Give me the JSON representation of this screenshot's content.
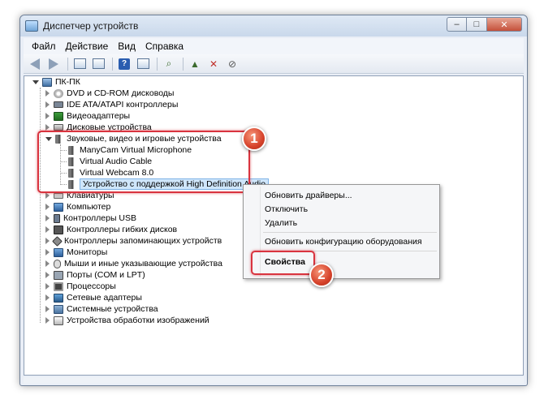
{
  "window": {
    "title": "Диспетчер устройств",
    "buttons": {
      "minimize": "–",
      "maximize": "□",
      "close": "✕"
    }
  },
  "menubar": [
    "Файл",
    "Действие",
    "Вид",
    "Справка"
  ],
  "toolbar": {
    "help_label": "?"
  },
  "tree": {
    "root": "ПК-ПК",
    "categories": [
      "DVD и CD-ROM дисководы",
      "IDE ATA/ATAPI контроллеры",
      "Видеоадаптеры",
      "Дисковые устройства",
      "Звуковые, видео и игровые устройства",
      "Клавиатуры",
      "Компьютер",
      "Контроллеры USB",
      "Контроллеры гибких дисков",
      "Контроллеры запоминающих устройств",
      "Мониторы",
      "Мыши и иные указывающие устройства",
      "Порты (COM и LPT)",
      "Процессоры",
      "Сетевые адаптеры",
      "Системные устройства",
      "Устройства обработки изображений"
    ],
    "sound_children": [
      "ManyCam Virtual Microphone",
      "Virtual Audio Cable",
      "Virtual Webcam 8.0",
      "Устройство с поддержкой High Definition Audio"
    ]
  },
  "context_menu": {
    "items": [
      "Обновить драйверы...",
      "Отключить",
      "Удалить",
      "Обновить конфигурацию оборудования",
      "Свойства"
    ]
  },
  "annotations": {
    "step1": "1",
    "step2": "2"
  },
  "colors": {
    "highlight": "#d9343f",
    "selection": "#cfe6fb"
  }
}
